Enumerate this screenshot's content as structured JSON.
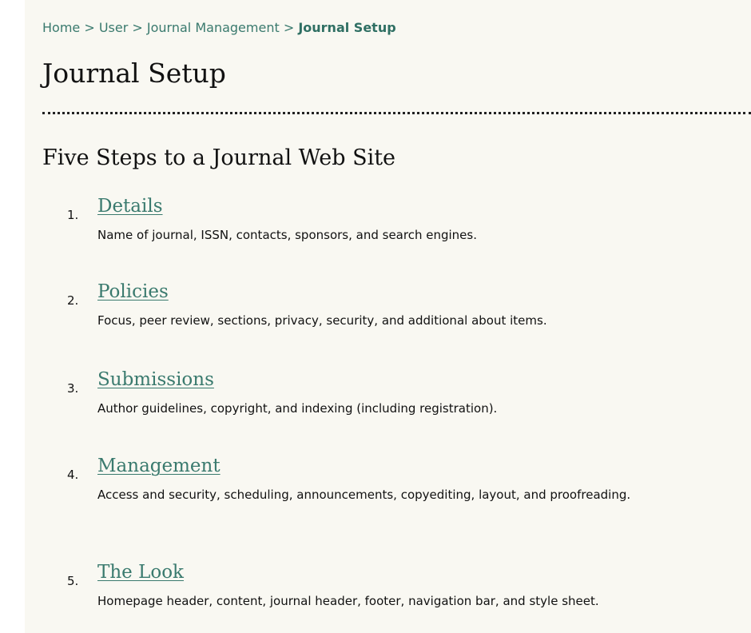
{
  "breadcrumb": {
    "items": [
      "Home",
      "User",
      "Journal Management"
    ],
    "separator": ">",
    "current": "Journal Setup"
  },
  "page_title": "Journal Setup",
  "section_heading": "Five Steps to a Journal Web Site",
  "steps": [
    {
      "number": "1.",
      "title": "Details",
      "description": "Name of journal, ISSN, contacts, sponsors, and search engines."
    },
    {
      "number": "2.",
      "title": "Policies",
      "description": "Focus, peer review, sections, privacy, security, and additional about items."
    },
    {
      "number": "3.",
      "title": "Submissions",
      "description": "Author guidelines, copyright, and indexing (including registration)."
    },
    {
      "number": "4.",
      "title": "Management",
      "description": "Access and security, scheduling, announcements, copyediting, layout, and proofreading."
    },
    {
      "number": "5.",
      "title": "The Look",
      "description": "Homepage header, content, journal header, footer, navigation bar, and style sheet."
    }
  ],
  "colors": {
    "link": "#3a7a6e",
    "page_background": "#f9f8f2",
    "text": "#111111"
  }
}
